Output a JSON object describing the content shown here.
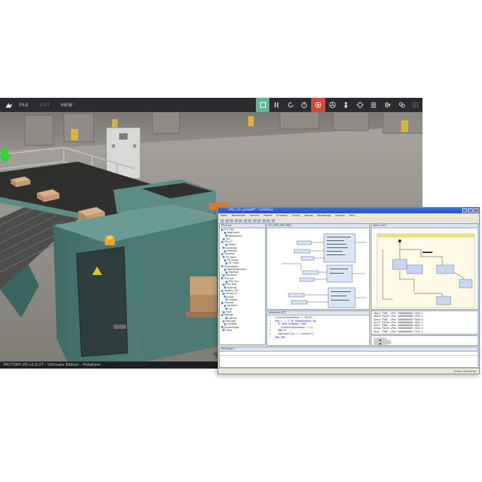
{
  "factory_io": {
    "menu": {
      "file": "FILE",
      "edit": "EDIT",
      "view": "VIEW"
    },
    "tools": [
      {
        "icon": "square-icon",
        "state": "active"
      },
      {
        "icon": "pause-icon"
      },
      {
        "icon": "reset-icon"
      },
      {
        "icon": "timer-icon"
      },
      {
        "icon": "camera-focus-icon",
        "state": "alert"
      },
      {
        "icon": "fan-icon"
      },
      {
        "icon": "person-icon"
      },
      {
        "icon": "diamond-icon"
      },
      {
        "icon": "list-icon"
      },
      {
        "icon": "drivers-icon"
      },
      {
        "icon": "link-icon"
      },
      {
        "icon": "grid-icon"
      }
    ],
    "status": "FACTORY I/O v2.0.27 - Ultimate Edition - Palletizer",
    "colors": {
      "toolbar": "#2b2c2e",
      "active": "#5db89a",
      "alert": "#d9453e",
      "machine": "#4f8078"
    }
  },
  "ide": {
    "title": "CNC_ein_projekt* - CoDeSys",
    "menu": [
      "Datei",
      "Bearbeiten",
      "Ansicht",
      "Projekt",
      "Erstellen",
      "Online",
      "Debug",
      "Werkzeuge",
      "Fenster",
      "Hilfe"
    ],
    "panes": {
      "project": "POUs.pro",
      "fbd": "PLC_PRG (PRG-FBD)",
      "sfc": "Ablauf (SFC)",
      "st": "Automatic (ST)",
      "messages": "Meldungen"
    },
    "tree": [
      "PLC_PRG",
      "Application",
      "Bibliotheken",
      "GVL",
      "GVL_IO",
      "Ablauf",
      "Automatic",
      "Palletizer",
      "Conveyor",
      "FB_Motor",
      "FB_Sensor",
      "FB_Timer",
      "Visualization",
      "Taskkonfiguration",
      "MainTask",
      "Bausteine",
      "POU_Init",
      "POU_Run",
      "POU_Stop",
      "Ethernet",
      "Modbus_TCP",
      "Factory_IO",
      "Inputs",
      "Outputs",
      "Libraries",
      "Standard",
      "Util",
      "Trace",
      "Rezepte",
      "Alarme",
      "Benutzer",
      "Symbole",
      "Einstellungen",
      "Gerät"
    ],
    "st_code": [
      "iCounterResetHand := FALSE;",
      "FOR i := 1 TO iNumberBoxes DO",
      "  IF bPalletReady THEN",
      "    iCounterResetHand := i;",
      "  END_IF",
      "  fbOutput(iIn := iCounter);",
      "END_FOR"
    ],
    "watch": [
      "xBox1 TRUE  iPos 16#00000002 %IX0.1",
      "xBox2 FALSE iPos 16#00000000 %IX0.2",
      "xConv TRUE  iPos 16#00000055 %QX0.0",
      "xLift FALSE iPos 16#00000002 %QX0.1",
      "xPall TRUE  iPos 16#00000093 %QX0.2",
      "xStop FALSE iPos 16#00000007 %IX1.0",
      "xRun  TRUE  iPos 16#00000001 %IX1.1"
    ],
    "status": "Online: Simulation"
  }
}
